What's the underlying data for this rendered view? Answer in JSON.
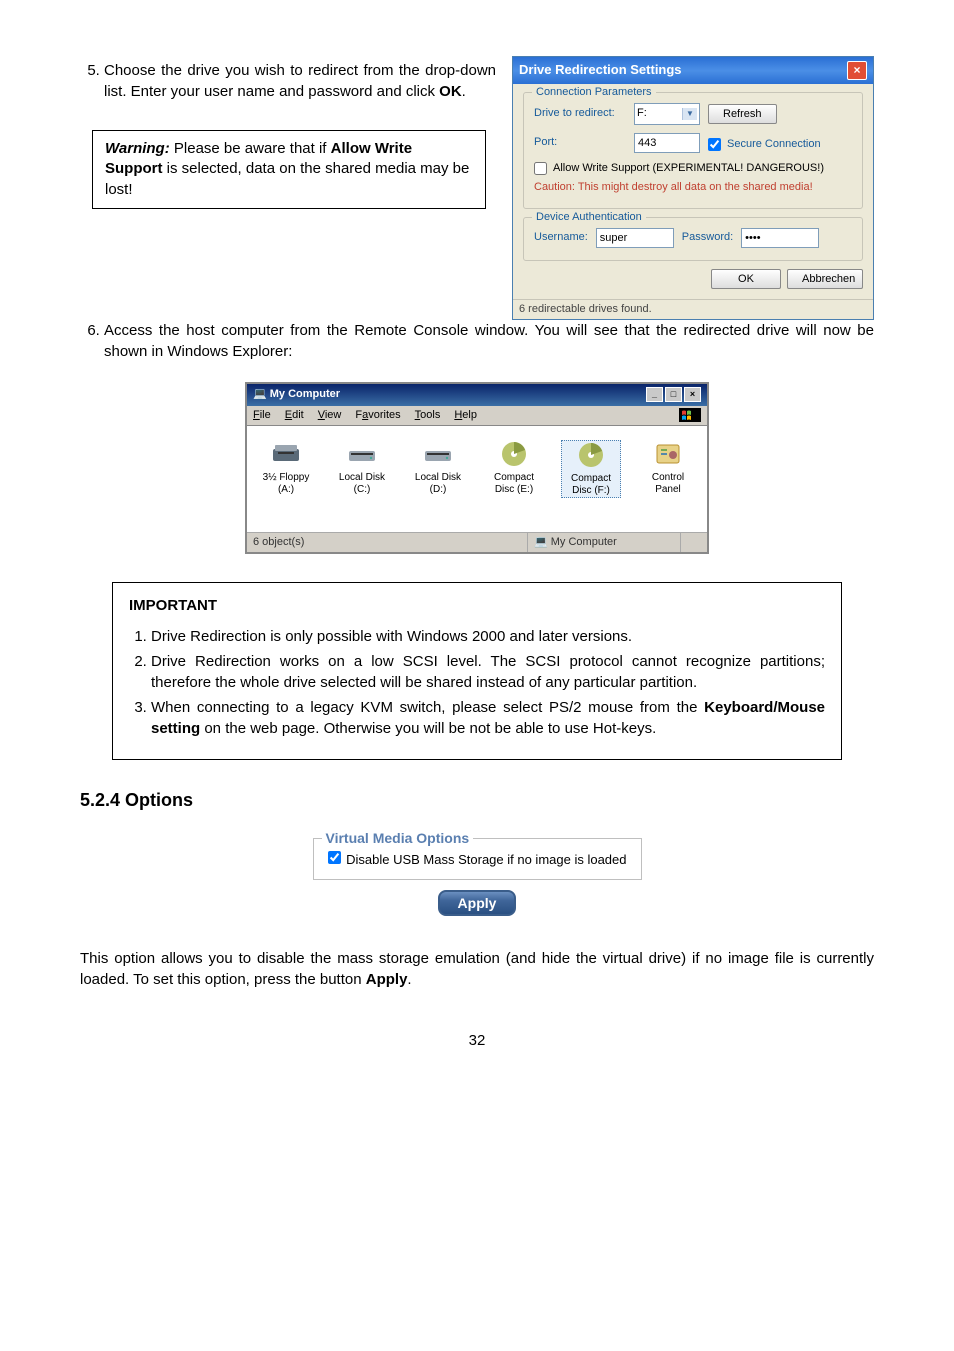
{
  "step5": {
    "text_part_a": "Choose the drive you wish to redirect from the drop-down list. Enter your user name and password and click ",
    "bold": "OK",
    "text_part_b": "."
  },
  "warning": {
    "label": "Warning:",
    "part_a": " Please be aware that if ",
    "bold1": "Allow Write Support",
    "part_b": " is selected, data on the shared media may be lost!"
  },
  "dialog": {
    "title": "Drive Redirection Settings",
    "conn": {
      "legend": "Connection Parameters",
      "drive_label": "Drive to redirect:",
      "drive_value": "F:",
      "refresh": "Refresh",
      "port_label": "Port:",
      "port_value": "443",
      "secure": "Secure Connection",
      "allow": "Allow Write Support (EXPERIMENTAL! DANGEROUS!)",
      "caution": "Caution: This might destroy all data on the shared media!"
    },
    "auth": {
      "legend": "Device Authentication",
      "user_label": "Username:",
      "user_value": "super",
      "pass_label": "Password:",
      "pass_value": "••••"
    },
    "ok": "OK",
    "cancel": "Abbrechen",
    "status": "6 redirectable drives found."
  },
  "step6": "Access the host computer from the Remote Console window. You will see that the redirected drive will now be shown in Windows Explorer:",
  "explorer": {
    "title": "My Computer",
    "menu": {
      "file": "File",
      "edit": "Edit",
      "view": "View",
      "fav": "Favorites",
      "tools": "Tools",
      "help": "Help"
    },
    "icons": {
      "a": "3½ Floppy (A:)",
      "c": "Local Disk (C:)",
      "d": "Local Disk (D:)",
      "e": "Compact Disc (E:)",
      "f": "Compact Disc (F:)",
      "cp": "Control Panel"
    },
    "status_left": "6 object(s)",
    "status_right": "My Computer"
  },
  "important": {
    "heading": "IMPORTANT",
    "i1": "Drive Redirection is only possible with Windows 2000 and later versions.",
    "i2": "Drive Redirection works on a low SCSI level. The SCSI protocol cannot recognize partitions; therefore the whole drive selected will be shared instead of any particular partition.",
    "i3_a": "When connecting to a legacy KVM switch, please select PS/2 mouse from the ",
    "i3_bold": "Keyboard/Mouse setting",
    "i3_b": " on the  web page. Otherwise you will be not be able to use Hot-keys."
  },
  "section": "5.2.4 Options",
  "vmo": {
    "legend": "Virtual Media Options",
    "check": "Disable USB Mass Storage if no image is loaded",
    "apply": "Apply"
  },
  "bottom": {
    "part_a": "This option allows you to disable the mass storage emulation (and hide the virtual drive) if no image file is currently loaded. To set this option, press the button ",
    "bold": "Apply",
    "part_b": "."
  },
  "pagenum": "32"
}
